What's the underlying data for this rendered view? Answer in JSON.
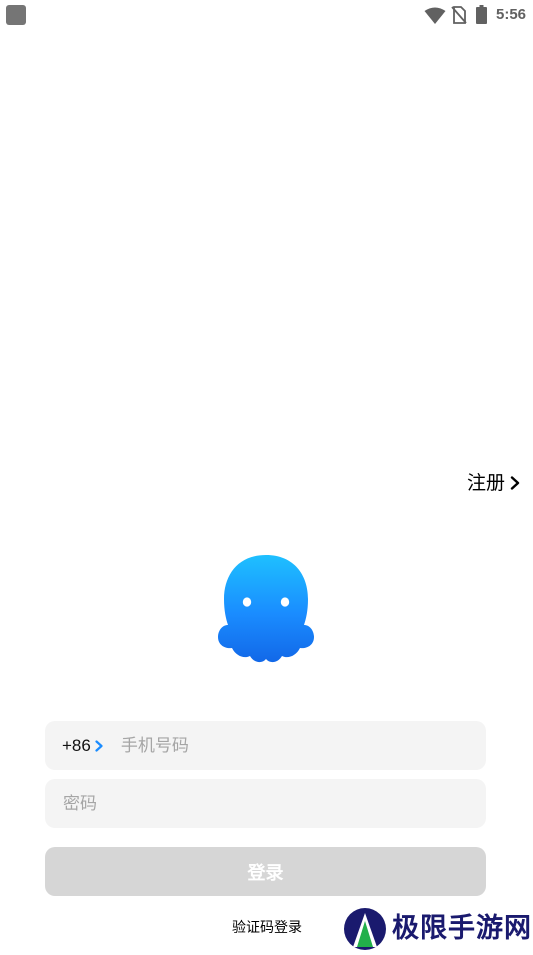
{
  "status_bar": {
    "time": "5:56",
    "icons": [
      "notification-icon",
      "wifi-icon",
      "no-sim-icon",
      "battery-icon"
    ]
  },
  "register": {
    "label": "注册",
    "icon": "chevron-right-icon"
  },
  "logo": {
    "icon": "octopus-mascot-icon",
    "color": "#1a8cff"
  },
  "phone_field": {
    "country_code": "+86",
    "value": "",
    "placeholder": "手机号码"
  },
  "password_field": {
    "value": "",
    "placeholder": "密码"
  },
  "login_button": {
    "label": "登录",
    "enabled": false
  },
  "sms_login": {
    "label": "验证码登录"
  },
  "watermark": {
    "text": "极限手游网"
  },
  "colors": {
    "accent": "#1a8cff",
    "field_background": "#f4f4f4",
    "button_disabled": "#d6d6d6",
    "placeholder": "#a5a5a5",
    "watermark_text": "#1a1a6e"
  }
}
